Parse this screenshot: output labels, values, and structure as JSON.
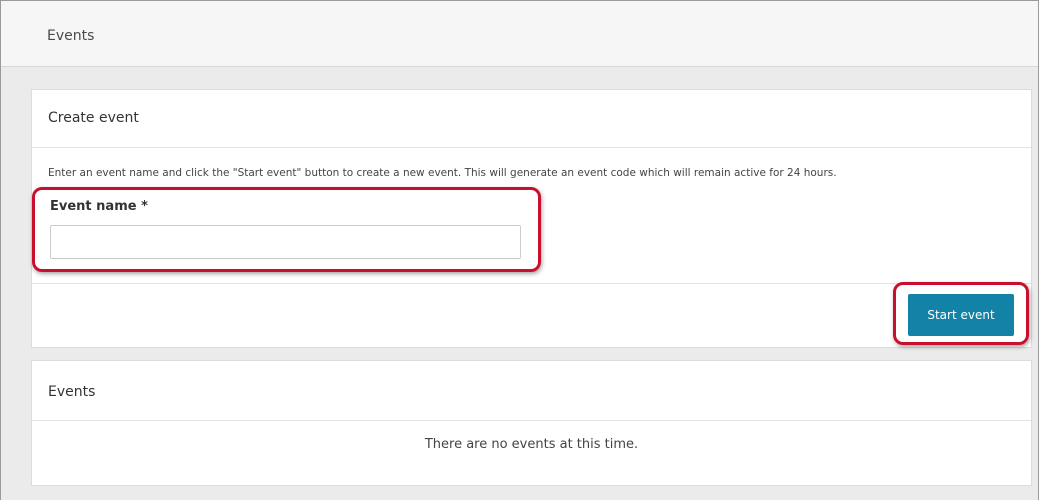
{
  "header": {
    "title": "Events"
  },
  "create_event": {
    "title": "Create event",
    "description": "Enter an event name and click the \"Start event\" button to create a new event. This will generate an event code which will remain active for 24 hours.",
    "field_label": "Event name *",
    "field_value": "",
    "field_placeholder": "",
    "start_button_label": "Start event"
  },
  "events_panel": {
    "title": "Events",
    "empty_message": "There are no events at this time."
  },
  "colors": {
    "accent_button": "#1282a6",
    "highlight_outline": "#c8102e",
    "background": "#ebebeb"
  }
}
